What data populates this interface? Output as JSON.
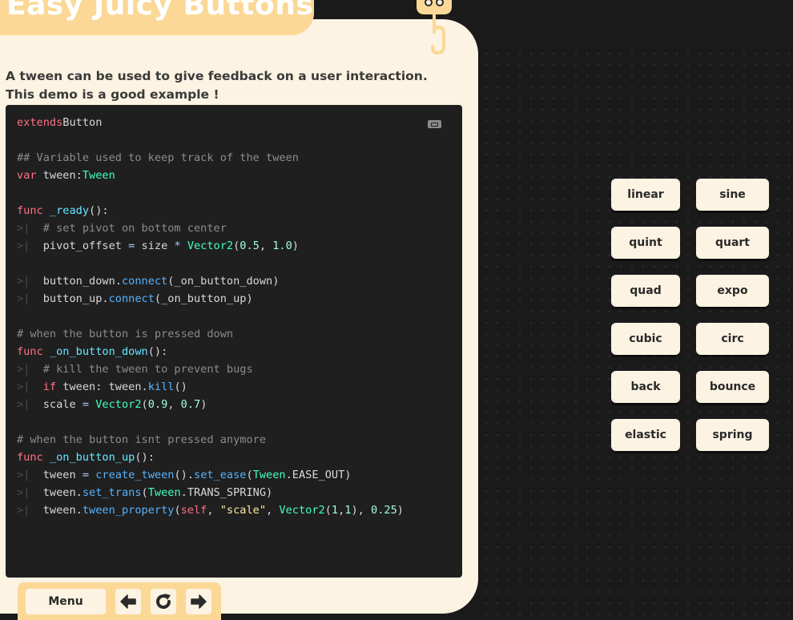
{
  "header": {
    "title": "Easy Juicy Buttons"
  },
  "description": {
    "line1": "A tween can be used to give feedback on a user interaction.",
    "line2": "This demo is a good example !"
  },
  "code": {
    "copy_icon": "copy-icon",
    "lines": [
      [
        [
          "kw",
          "extends"
        ],
        [
          "",
          "Button"
        ]
      ],
      [],
      [
        [
          "cm",
          "## Variable used to keep track of the tween"
        ]
      ],
      [
        [
          "kw",
          "var"
        ],
        [
          "",
          " tween:"
        ],
        [
          "ty",
          "Tween"
        ]
      ],
      [],
      [
        [
          "kw",
          "func"
        ],
        [
          "",
          " "
        ],
        [
          "dfn",
          "_ready"
        ],
        [
          "",
          "():"
        ]
      ],
      [
        [
          "tab",
          ">|"
        ],
        [
          "",
          "  "
        ],
        [
          "cm",
          "# set pivot on bottom center"
        ]
      ],
      [
        [
          "tab",
          ">|"
        ],
        [
          "",
          "  pivot_offset "
        ],
        [
          "op",
          "="
        ],
        [
          "",
          " size "
        ],
        [
          "op",
          "*"
        ],
        [
          "",
          " "
        ],
        [
          "ty",
          "Vector2"
        ],
        [
          "",
          "("
        ],
        [
          "nu",
          "0.5"
        ],
        [
          "",
          ", "
        ],
        [
          "nu",
          "1.0"
        ],
        [
          "",
          ")"
        ]
      ],
      [],
      [
        [
          "tab",
          ">|"
        ],
        [
          "",
          "  button_down."
        ],
        [
          "fn",
          "connect"
        ],
        [
          "",
          "(_on_button_down)"
        ]
      ],
      [
        [
          "tab",
          ">|"
        ],
        [
          "",
          "  button_up."
        ],
        [
          "fn",
          "connect"
        ],
        [
          "",
          "(_on_button_up)"
        ]
      ],
      [],
      [
        [
          "cm",
          "# when the button is pressed down"
        ]
      ],
      [
        [
          "kw",
          "func"
        ],
        [
          "",
          " "
        ],
        [
          "dfn",
          "_on_button_down"
        ],
        [
          "",
          "():"
        ]
      ],
      [
        [
          "tab",
          ">|"
        ],
        [
          "",
          "  "
        ],
        [
          "cm",
          "# kill the tween to prevent bugs"
        ]
      ],
      [
        [
          "tab",
          ">|"
        ],
        [
          "",
          "  "
        ],
        [
          "kw",
          "if"
        ],
        [
          "",
          " tween: tween."
        ],
        [
          "fn",
          "kill"
        ],
        [
          "",
          "()"
        ]
      ],
      [
        [
          "tab",
          ">|"
        ],
        [
          "",
          "  scale "
        ],
        [
          "op",
          "="
        ],
        [
          "",
          " "
        ],
        [
          "ty",
          "Vector2"
        ],
        [
          "",
          "("
        ],
        [
          "nu",
          "0.9"
        ],
        [
          "",
          ", "
        ],
        [
          "nu",
          "0.7"
        ],
        [
          "",
          ")"
        ]
      ],
      [],
      [
        [
          "cm",
          "# when the button isnt pressed anymore"
        ]
      ],
      [
        [
          "kw",
          "func"
        ],
        [
          "",
          " "
        ],
        [
          "dfn",
          "_on_button_up"
        ],
        [
          "",
          "():"
        ]
      ],
      [
        [
          "tab",
          ">|"
        ],
        [
          "",
          "  tween "
        ],
        [
          "op",
          "="
        ],
        [
          "",
          " "
        ],
        [
          "fn",
          "create_tween"
        ],
        [
          "",
          "()."
        ],
        [
          "fn",
          "set_ease"
        ],
        [
          "",
          "("
        ],
        [
          "ty",
          "Tween"
        ],
        [
          "",
          ".EASE_OUT)"
        ]
      ],
      [
        [
          "tab",
          ">|"
        ],
        [
          "",
          "  tween."
        ],
        [
          "fn",
          "set_trans"
        ],
        [
          "",
          "("
        ],
        [
          "ty",
          "Tween"
        ],
        [
          "",
          ".TRANS_SPRING)"
        ]
      ],
      [
        [
          "tab",
          ">|"
        ],
        [
          "",
          "  tween."
        ],
        [
          "fn",
          "tween_property"
        ],
        [
          "",
          "("
        ],
        [
          "kw",
          "self"
        ],
        [
          "",
          ", "
        ],
        [
          "st",
          "\"scale\""
        ],
        [
          "",
          ", "
        ],
        [
          "ty",
          "Vector2"
        ],
        [
          "",
          "("
        ],
        [
          "nu",
          "1"
        ],
        [
          "",
          ","
        ],
        [
          "nu",
          "1"
        ],
        [
          "",
          "), "
        ],
        [
          "nu",
          "0.25"
        ],
        [
          "",
          ")"
        ]
      ]
    ]
  },
  "nav": {
    "menu_label": "Menu",
    "prev_icon": "arrow-left-icon",
    "restart_icon": "restart-icon",
    "next_icon": "arrow-right-icon"
  },
  "tween_buttons": [
    {
      "label": "linear"
    },
    {
      "label": "sine"
    },
    {
      "label": "quint"
    },
    {
      "label": "quart"
    },
    {
      "label": "quad"
    },
    {
      "label": "expo"
    },
    {
      "label": "cubic"
    },
    {
      "label": "circ"
    },
    {
      "label": "back"
    },
    {
      "label": "bounce"
    },
    {
      "label": "elastic"
    },
    {
      "label": "spring"
    }
  ],
  "colors": {
    "background": "#1a1a1a",
    "panel": "#fdf3e3",
    "accent": "#fbd896",
    "code_bg": "#1f1f1f"
  }
}
